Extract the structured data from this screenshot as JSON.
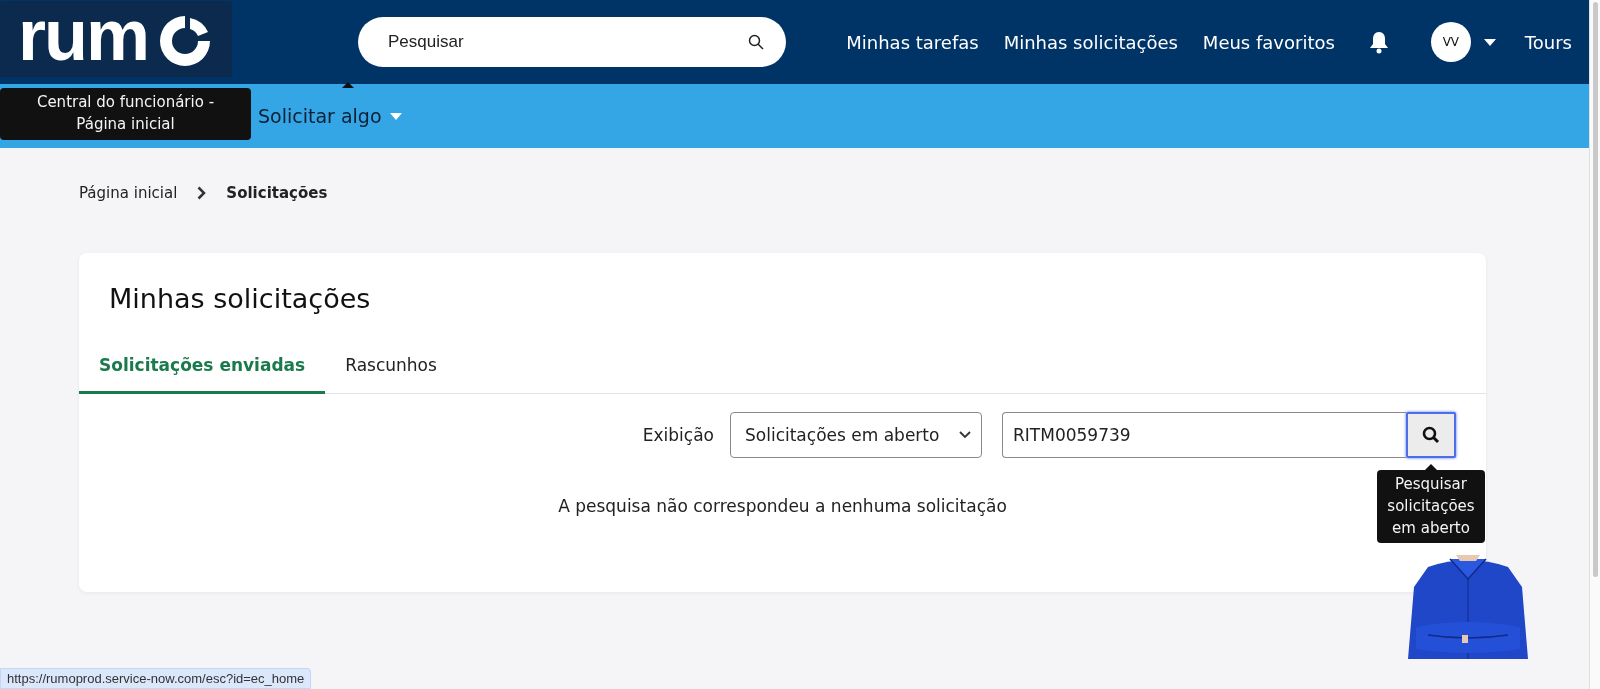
{
  "header": {
    "logo_text": "rum",
    "search": {
      "placeholder": "Pesquisar"
    },
    "links": [
      {
        "label": "Minhas tarefas"
      },
      {
        "label": "Minhas solicitações"
      },
      {
        "label": "Meus favoritos"
      }
    ],
    "avatar": "VV",
    "tours": "Tours"
  },
  "logo_tooltip": "Central do funcionário - Página inicial",
  "nav": [
    {
      "label": "Solicitar algo"
    }
  ],
  "breadcrumb": [
    {
      "label": "Página inicial",
      "selected": false
    },
    {
      "label": "Solicitações",
      "selected": true
    }
  ],
  "card": {
    "title": "Minhas solicitações",
    "tabs": [
      {
        "label": "Solicitações enviadas",
        "selected": true
      },
      {
        "label": "Rascunhos",
        "selected": false
      }
    ],
    "filter_label": "Exibição",
    "filter_value": "Solicitações em aberto",
    "search_value": "RITM0059739",
    "search_tooltip": "Pesquisar solicitações em aberto",
    "empty_message": "A pesquisa não correspondeu a nenhuma solicitação"
  },
  "status_url": "https://rumoprod.service-now.com/esc?id=ec_home"
}
